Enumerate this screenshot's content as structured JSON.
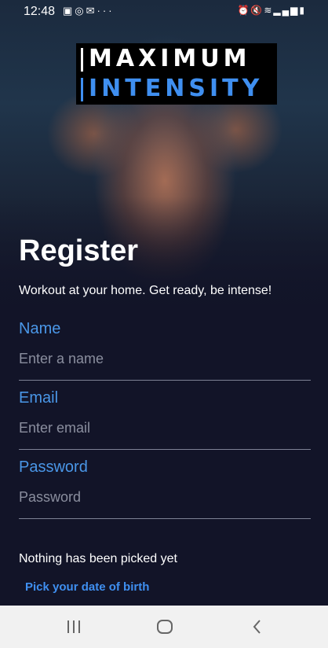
{
  "status_bar": {
    "time": "12:48",
    "left_icons": [
      "image-icon",
      "whatsapp-icon",
      "message-icon",
      "more-icon"
    ],
    "right_icons": [
      "alarm-icon",
      "mute-icon",
      "wifi-icon",
      "signal-icon",
      "battery-icon"
    ]
  },
  "logo": {
    "line1": "MAXIMUM",
    "line2": "INTENSITY",
    "line2_color": "#3f8ff0"
  },
  "title": "Register",
  "subtitle": "Workout at your home. Get ready, be intense!",
  "form": {
    "name": {
      "label": "Name",
      "placeholder": "Enter a name",
      "value": ""
    },
    "email": {
      "label": "Email",
      "placeholder": "Enter email",
      "value": ""
    },
    "password": {
      "label": "Password",
      "placeholder": "Password",
      "value": ""
    }
  },
  "dob": {
    "status": "Nothing has been picked yet",
    "button_label": "Pick your date of birth"
  },
  "nav": {
    "buttons": [
      "recents-icon",
      "home-icon",
      "back-icon"
    ]
  },
  "colors": {
    "accent": "#4a97e8",
    "background": "#121428"
  }
}
